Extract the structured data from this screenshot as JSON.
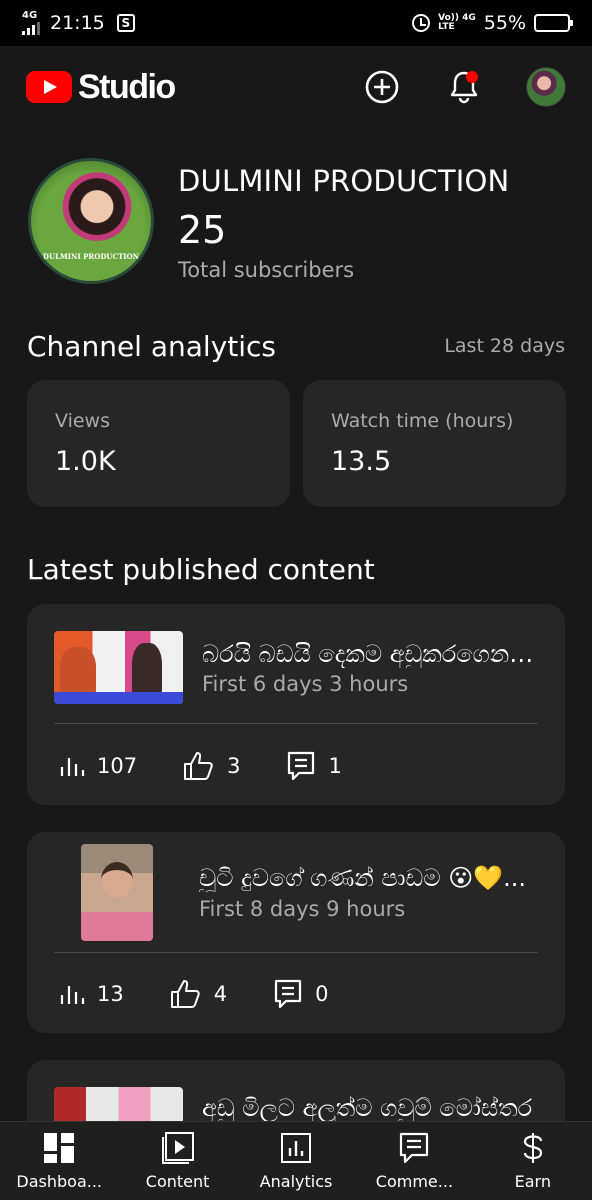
{
  "status_bar": {
    "network": "4G",
    "time": "21:15",
    "notification_icon": "S",
    "volte_top": "Vo)) 4G",
    "volte_bottom": "LTE",
    "battery": "55%",
    "battery_level": 0.55
  },
  "app": {
    "logo_text": "Studio"
  },
  "channel": {
    "name": "DULMINI PRODUCTION",
    "avatar_caption": "DULMINI PRODUCTION",
    "subscribers": "25",
    "subscribers_label": "Total subscribers"
  },
  "analytics": {
    "title": "Channel analytics",
    "period": "Last 28 days",
    "cards": [
      {
        "label": "Views",
        "value": "1.0K"
      },
      {
        "label": "Watch time (hours)",
        "value": "13.5"
      }
    ]
  },
  "latest": {
    "title": "Latest published content",
    "videos": [
      {
        "title": "බරයි බඩයි දෙකම අඩුකරගෙන ලස්සන වෙන්න",
        "meta": "First 6 days 3 hours",
        "views": "107",
        "likes": "3",
        "comments": "1"
      },
      {
        "title": "චූටි දුවගේ ගණන් පාඩම 😮💛...",
        "meta": "First 8 days 9 hours",
        "views": "13",
        "likes": "4",
        "comments": "0"
      },
      {
        "title": "අඩු මිලට අලුත්ම ගවුම් මෝස්තර",
        "meta": "",
        "views": "",
        "likes": "",
        "comments": ""
      }
    ]
  },
  "nav": {
    "items": [
      {
        "label": "Dashboa..."
      },
      {
        "label": "Content"
      },
      {
        "label": "Analytics"
      },
      {
        "label": "Comme..."
      },
      {
        "label": "Earn"
      }
    ]
  },
  "colors": {
    "accent": "#ff0000",
    "background": "#181818",
    "card": "#262626",
    "battery": "#f5b400"
  }
}
